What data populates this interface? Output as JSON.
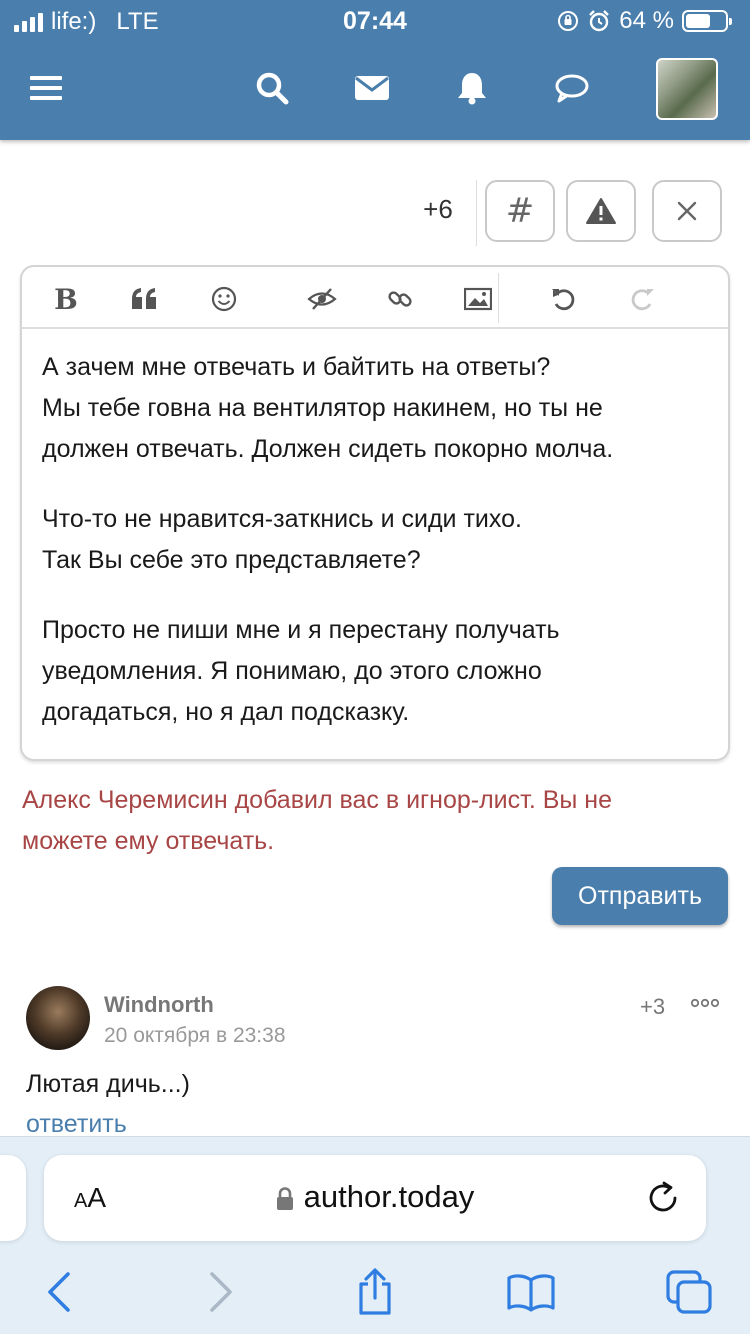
{
  "status_bar": {
    "carrier": "life:)",
    "network": "LTE",
    "time": "07:44",
    "battery": "64 %",
    "battery_level": 0.64
  },
  "header": {
    "icons": [
      "menu-icon",
      "search-icon",
      "mail-icon",
      "bell-icon",
      "chat-icon"
    ]
  },
  "post_actions": {
    "votes": "+6",
    "hash_label": "#"
  },
  "editor": {
    "toolbar": [
      "bold",
      "quote",
      "emoji",
      "spoiler",
      "link",
      "image",
      "undo",
      "redo"
    ],
    "bold_label": "B",
    "paragraphs": [
      [
        "А зачем мне отвечать и байтить на ответы?",
        "Мы тебе говна на вентилятор накинем, но ты не",
        "должен отвечать. Должен сидеть покорно молча."
      ],
      [
        "Что-то не нравится-заткнись и сиди тихо.",
        "Так Вы себе это представляете?"
      ],
      [
        "Просто не пиши мне и я перестану получать",
        "уведомления. Я понимаю, до этого сложно",
        "догадаться, но я дал подсказку."
      ]
    ]
  },
  "notice": {
    "line1": "Алекс Черемисин добавил вас в игнор-лист. Вы не",
    "line2": "можете ему отвечать."
  },
  "send_button": "Отправить",
  "comment": {
    "author": "Windnorth",
    "date": "20 октября в 23:38",
    "votes": "+3",
    "text": "Лютая дичь...)",
    "reply": "ответить"
  },
  "safari": {
    "text_size_small": "A",
    "text_size_large": "A",
    "url": "author.today"
  },
  "colors": {
    "header": "#4a7ead",
    "warning_text": "#a84646",
    "link": "#4a7ead",
    "safari_accent": "#2f7de1"
  }
}
